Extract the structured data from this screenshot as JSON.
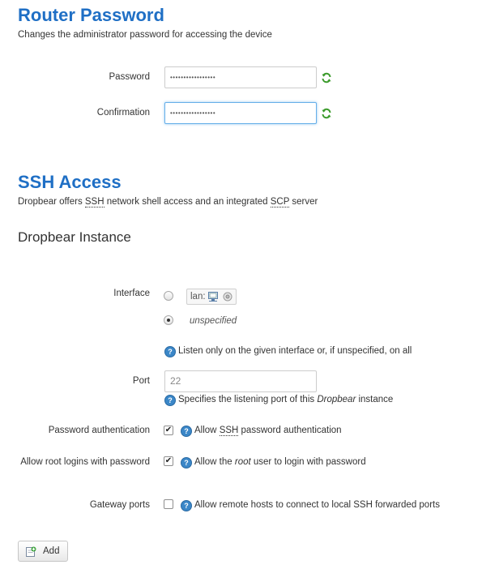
{
  "router_password": {
    "title": "Router Password",
    "description": "Changes the administrator password for accessing the device",
    "password_label": "Password",
    "password_value": "•••••••••••••••••",
    "confirmation_label": "Confirmation",
    "confirmation_value": "•••••••••••••••••"
  },
  "ssh_access": {
    "title": "SSH Access",
    "description_prefix": "Dropbear offers ",
    "description_ssh": "SSH",
    "description_mid": " network shell access and an integrated ",
    "description_scp": "SCP",
    "description_suffix": " server",
    "instance_title": "Dropbear Instance",
    "interface": {
      "label": "Interface",
      "option_lan": "lan:",
      "option_unspecified": "unspecified",
      "selected": "unspecified",
      "help": "Listen only on the given interface or, if unspecified, on all"
    },
    "port": {
      "label": "Port",
      "placeholder": "22",
      "value": "",
      "help_prefix": "Specifies the listening port of this ",
      "help_em": "Dropbear",
      "help_suffix": " instance"
    },
    "password_auth": {
      "label": "Password authentication",
      "checked": true,
      "help_prefix": "Allow ",
      "help_abbr": "SSH",
      "help_suffix": " password authentication"
    },
    "root_login": {
      "label": "Allow root logins with password",
      "checked": true,
      "help_prefix": "Allow the ",
      "help_em": "root",
      "help_suffix": " user to login with password"
    },
    "gateway_ports": {
      "label": "Gateway ports",
      "checked": false,
      "help": "Allow remote hosts to connect to local SSH forwarded ports"
    },
    "add_button": "Add"
  },
  "colors": {
    "heading": "#1f6fc5",
    "focus_border": "#66afe9",
    "help_icon": "#3b87c8",
    "reveal_icon": "#3a9a2a"
  },
  "icons": {
    "reveal": "refresh-reveal-icon",
    "help": "help-icon",
    "add": "add-icon",
    "network": "network-icon",
    "wireless": "wireless-icon"
  }
}
